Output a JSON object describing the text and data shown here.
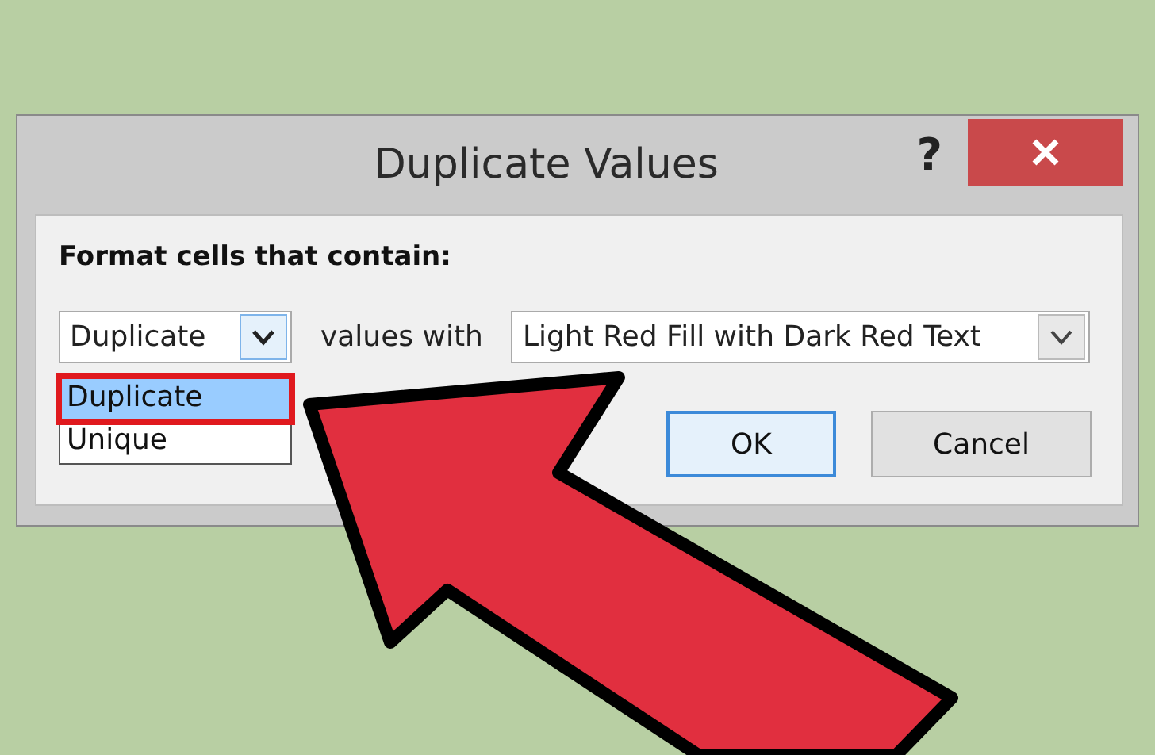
{
  "window": {
    "title": "Duplicate Values",
    "help": "?"
  },
  "label": "Format cells that contain:",
  "type_select": {
    "value": "Duplicate",
    "expanded": true,
    "options": [
      {
        "label": "Duplicate",
        "selected": true,
        "highlighted": true
      },
      {
        "label": "Unique",
        "selected": false,
        "highlighted": false
      }
    ]
  },
  "connector": "values with",
  "format_select": {
    "value": "Light Red Fill with Dark Red Text"
  },
  "buttons": [
    {
      "label": "OK",
      "default": true
    },
    {
      "label": "Cancel",
      "default": false
    }
  ]
}
